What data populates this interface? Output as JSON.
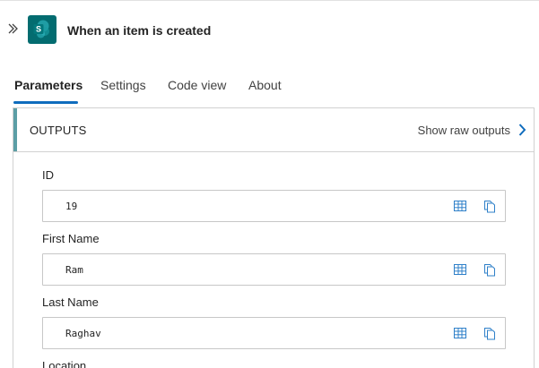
{
  "header": {
    "title": "When an item is created",
    "connector_icon": "sharepoint-icon",
    "connector_badge": "S",
    "brand_color": "#036c70"
  },
  "tabs": [
    {
      "label": "Parameters",
      "active": true
    },
    {
      "label": "Settings",
      "active": false
    },
    {
      "label": "Code view",
      "active": false
    },
    {
      "label": "About",
      "active": false
    }
  ],
  "outputs": {
    "title": "OUTPUTS",
    "raw_outputs_label": "Show raw outputs",
    "accent_color": "#5c9ea5",
    "fields": [
      {
        "label": "ID",
        "value": "19"
      },
      {
        "label": "First Name",
        "value": "Ram"
      },
      {
        "label": "Last Name",
        "value": "Raghav"
      },
      {
        "label": "Location",
        "value": ""
      }
    ]
  },
  "accent_color": "#0f6cbd"
}
